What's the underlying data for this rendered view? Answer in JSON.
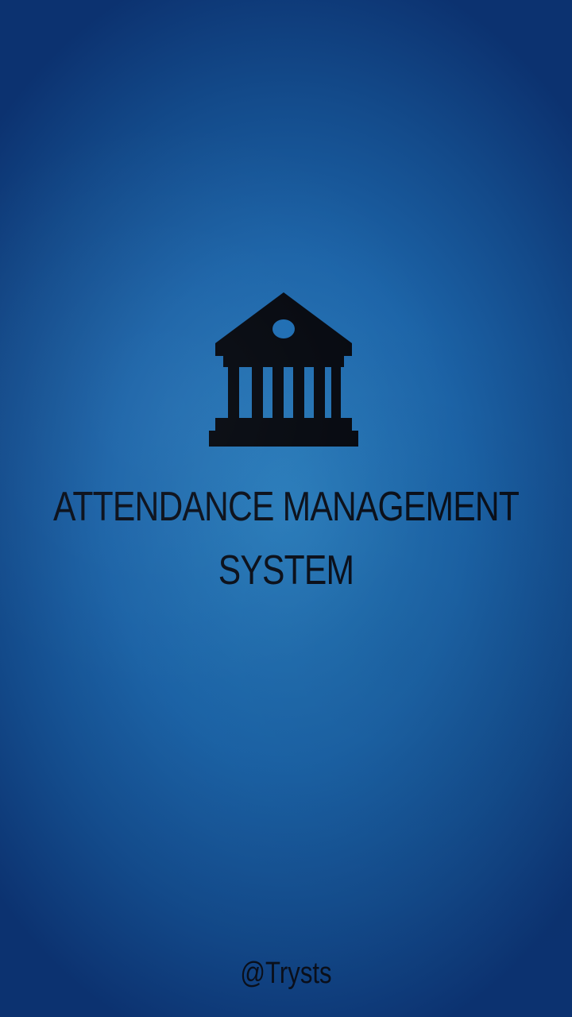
{
  "splash": {
    "logo_icon": "institution-building-icon",
    "title_line1": "ATTENDANCE  MANAGEMENT",
    "title_line2": "SYSTEM",
    "handle": "@Trysts"
  },
  "colors": {
    "background_center": "#2a7fbf",
    "background_edge": "#0c3270",
    "text": "#0a0f1a"
  }
}
